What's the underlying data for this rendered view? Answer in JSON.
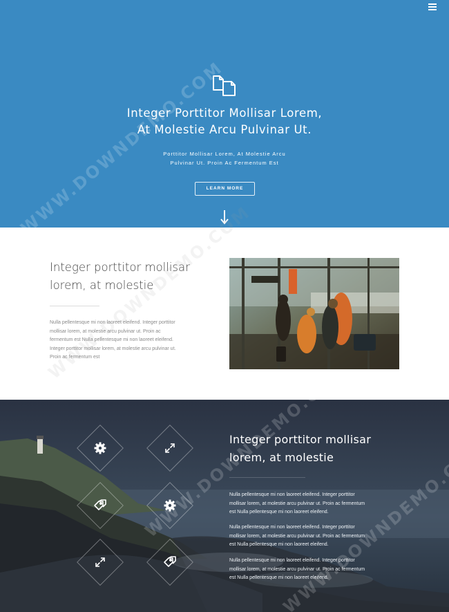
{
  "nav": {
    "menu_icon": "hamburger-menu-icon"
  },
  "hero": {
    "icon": "copy-documents-icon",
    "title_line1": "Integer Porttitor Mollisar Lorem,",
    "title_line2": "At Molestie Arcu Pulvinar Ut.",
    "sub_line1": "Porttitor Mollisar Lorem, At Molestie Arcu",
    "sub_line2": "Pulvinar Ut. Proin Ac Fermentum Est",
    "button_label": "LEARN MORE",
    "scroll_icon": "arrow-down-icon"
  },
  "about": {
    "title_line1": "Integer porttitor mollisar",
    "title_line2": "lorem, at molestie",
    "text_lines": [
      "Nulla pellentesque mi non laoreet eleifend. Integer porttitor",
      "mollisar lorem, at molestie arcu pulvinar ut. Proin ac",
      "fermentum est Nulla pellentesque mi non laoreet eleifend.",
      "Integer porttitor mollisar lorem, at molestie arcu pulvinar ut.",
      "Proin ac fermentum est"
    ]
  },
  "features": {
    "title_line1": "Integer porttitor mollisar",
    "title_line2": "lorem, at molestie",
    "icons": [
      "gear-icon",
      "resize-icon",
      "tags-icon",
      "gear-icon",
      "resize-icon",
      "tags-icon"
    ],
    "paragraphs": [
      [
        "Nulla pellentesque mi non laoreet eleifend. Integer porttitor",
        "mollisar lorem, at molestie arcu pulvinar ut. Proin ac fermentum",
        "est Nulla pellentesque mi non laoreet eleifend."
      ],
      [
        "Nulla pellentesque mi non laoreet eleifend. Integer porttitor",
        "mollisar lorem, at molestie arcu pulvinar ut. Proin ac fermentum",
        "est Nulla pellentesque mi non laoreet eleifend."
      ],
      [
        "Nulla pellentesque mi non laoreet eleifend. Integer porttitor",
        "mollisar lorem, at molestie arcu pulvinar ut. Proin ac fermentum",
        "est Nulla pellentesque mi non laoreet eleifend."
      ]
    ]
  },
  "watermark": "WWW.DOWNDEMO.COM",
  "colors": {
    "hero_bg": "#3a8ac2",
    "dark_bg": "#2b3444",
    "heading": "#444444",
    "body_text": "#8a8a8a"
  }
}
